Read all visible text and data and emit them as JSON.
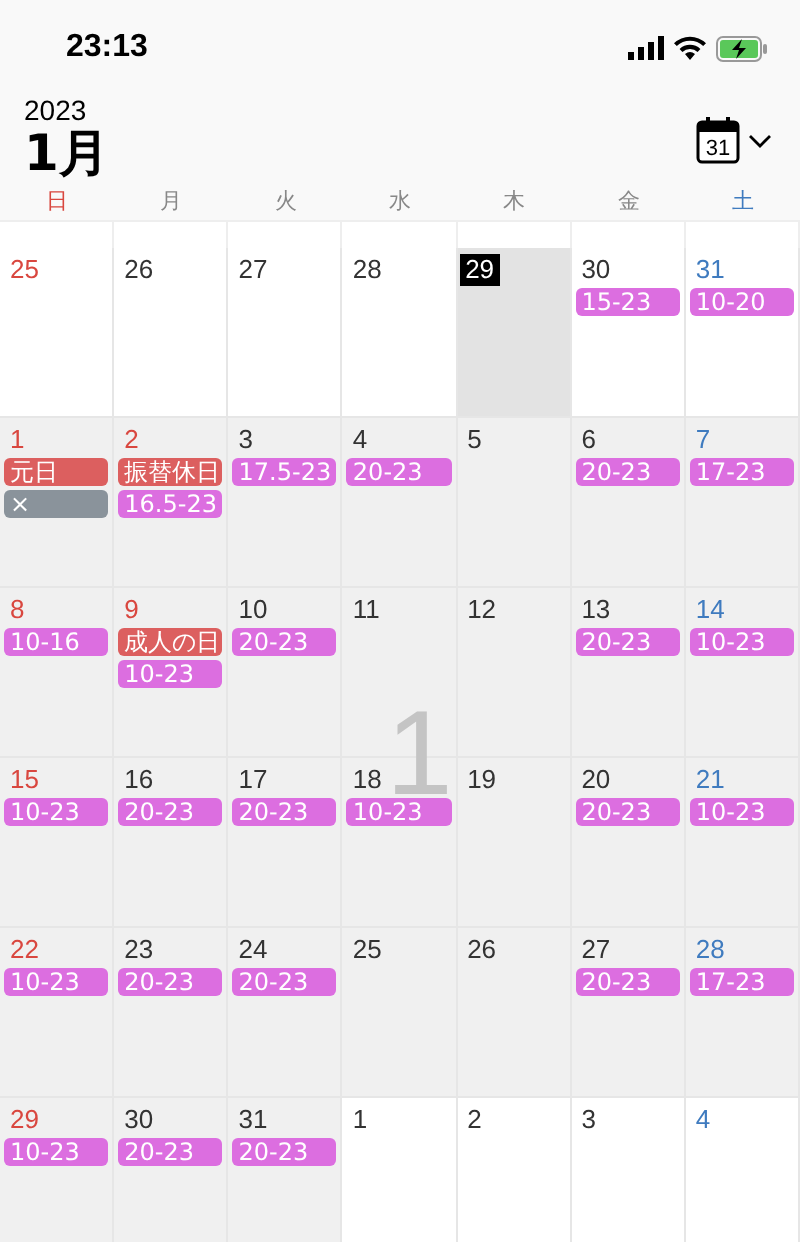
{
  "status_bar": {
    "time": "23:13"
  },
  "header": {
    "year": "2023",
    "month": "1月",
    "calendar_button_day": "31",
    "month_overlay": "1"
  },
  "weekdays": [
    {
      "label": "日",
      "kind": "sunday"
    },
    {
      "label": "月",
      "kind": "weekday"
    },
    {
      "label": "火",
      "kind": "weekday"
    },
    {
      "label": "水",
      "kind": "weekday"
    },
    {
      "label": "木",
      "kind": "weekday"
    },
    {
      "label": "金",
      "kind": "weekday"
    },
    {
      "label": "土",
      "kind": "saturday"
    }
  ],
  "weeks": [
    [
      {
        "day": "25",
        "in_month": false,
        "selected": false
      },
      {
        "day": "26",
        "in_month": false,
        "selected": false
      },
      {
        "day": "27",
        "in_month": false,
        "selected": false
      },
      {
        "day": "28",
        "in_month": false,
        "selected": false
      },
      {
        "day": "29",
        "in_month": false,
        "selected": true
      },
      {
        "day": "30",
        "in_month": false,
        "selected": false,
        "events": [
          {
            "title": "15-23",
            "color": "#dc6ee0"
          }
        ]
      },
      {
        "day": "31",
        "in_month": false,
        "selected": false,
        "events": [
          {
            "title": "10-20",
            "color": "#dc6ee0"
          }
        ]
      }
    ],
    [
      {
        "day": "1",
        "in_month": true,
        "selected": false,
        "events": [
          {
            "title": "元日",
            "color": "#dc5f5f"
          },
          {
            "title": "×",
            "color": "#8a939b"
          }
        ]
      },
      {
        "day": "2",
        "in_month": true,
        "selected": false,
        "holiday": true,
        "events": [
          {
            "title": "振替休日",
            "color": "#dc5f5f"
          },
          {
            "title": "16.5-23",
            "color": "#dc6ee0"
          }
        ]
      },
      {
        "day": "3",
        "in_month": true,
        "selected": false,
        "events": [
          {
            "title": "17.5-23",
            "color": "#dc6ee0"
          }
        ]
      },
      {
        "day": "4",
        "in_month": true,
        "selected": false,
        "events": [
          {
            "title": "20-23",
            "color": "#dc6ee0"
          }
        ]
      },
      {
        "day": "5",
        "in_month": true,
        "selected": false
      },
      {
        "day": "6",
        "in_month": true,
        "selected": false,
        "events": [
          {
            "title": "20-23",
            "color": "#dc6ee0"
          }
        ]
      },
      {
        "day": "7",
        "in_month": true,
        "selected": false,
        "events": [
          {
            "title": "17-23",
            "color": "#dc6ee0"
          }
        ]
      }
    ],
    [
      {
        "day": "8",
        "in_month": true,
        "selected": false,
        "events": [
          {
            "title": "10-16",
            "color": "#dc6ee0"
          }
        ]
      },
      {
        "day": "9",
        "in_month": true,
        "selected": false,
        "holiday": true,
        "events": [
          {
            "title": "成人の日",
            "color": "#dc5f5f"
          },
          {
            "title": "10-23",
            "color": "#dc6ee0"
          }
        ]
      },
      {
        "day": "10",
        "in_month": true,
        "selected": false,
        "events": [
          {
            "title": "20-23",
            "color": "#dc6ee0"
          }
        ]
      },
      {
        "day": "11",
        "in_month": true,
        "selected": false
      },
      {
        "day": "12",
        "in_month": true,
        "selected": false
      },
      {
        "day": "13",
        "in_month": true,
        "selected": false,
        "events": [
          {
            "title": "20-23",
            "color": "#dc6ee0"
          }
        ]
      },
      {
        "day": "14",
        "in_month": true,
        "selected": false,
        "events": [
          {
            "title": "10-23",
            "color": "#dc6ee0"
          }
        ]
      }
    ],
    [
      {
        "day": "15",
        "in_month": true,
        "selected": false,
        "events": [
          {
            "title": "10-23",
            "color": "#dc6ee0"
          }
        ]
      },
      {
        "day": "16",
        "in_month": true,
        "selected": false,
        "events": [
          {
            "title": "20-23",
            "color": "#dc6ee0"
          }
        ]
      },
      {
        "day": "17",
        "in_month": true,
        "selected": false,
        "events": [
          {
            "title": "20-23",
            "color": "#dc6ee0"
          }
        ]
      },
      {
        "day": "18",
        "in_month": true,
        "selected": false,
        "events": [
          {
            "title": "10-23",
            "color": "#dc6ee0"
          }
        ]
      },
      {
        "day": "19",
        "in_month": true,
        "selected": false
      },
      {
        "day": "20",
        "in_month": true,
        "selected": false,
        "events": [
          {
            "title": "20-23",
            "color": "#dc6ee0"
          }
        ]
      },
      {
        "day": "21",
        "in_month": true,
        "selected": false,
        "events": [
          {
            "title": "10-23",
            "color": "#dc6ee0"
          }
        ]
      }
    ],
    [
      {
        "day": "22",
        "in_month": true,
        "selected": false,
        "events": [
          {
            "title": "10-23",
            "color": "#dc6ee0"
          }
        ]
      },
      {
        "day": "23",
        "in_month": true,
        "selected": false,
        "events": [
          {
            "title": "20-23",
            "color": "#dc6ee0"
          }
        ]
      },
      {
        "day": "24",
        "in_month": true,
        "selected": false,
        "events": [
          {
            "title": "20-23",
            "color": "#dc6ee0"
          }
        ]
      },
      {
        "day": "25",
        "in_month": true,
        "selected": false
      },
      {
        "day": "26",
        "in_month": true,
        "selected": false
      },
      {
        "day": "27",
        "in_month": true,
        "selected": false,
        "events": [
          {
            "title": "20-23",
            "color": "#dc6ee0"
          }
        ]
      },
      {
        "day": "28",
        "in_month": true,
        "selected": false,
        "events": [
          {
            "title": "17-23",
            "color": "#dc6ee0"
          }
        ]
      }
    ],
    [
      {
        "day": "29",
        "in_month": true,
        "selected": false,
        "events": [
          {
            "title": "10-23",
            "color": "#dc6ee0"
          }
        ]
      },
      {
        "day": "30",
        "in_month": true,
        "selected": false,
        "events": [
          {
            "title": "20-23",
            "color": "#dc6ee0"
          }
        ]
      },
      {
        "day": "31",
        "in_month": true,
        "selected": false,
        "events": [
          {
            "title": "20-23",
            "color": "#dc6ee0"
          }
        ]
      },
      {
        "day": "1",
        "in_month": false,
        "selected": false
      },
      {
        "day": "2",
        "in_month": false,
        "selected": false
      },
      {
        "day": "3",
        "in_month": false,
        "selected": false
      },
      {
        "day": "4",
        "in_month": false,
        "selected": false
      }
    ]
  ]
}
